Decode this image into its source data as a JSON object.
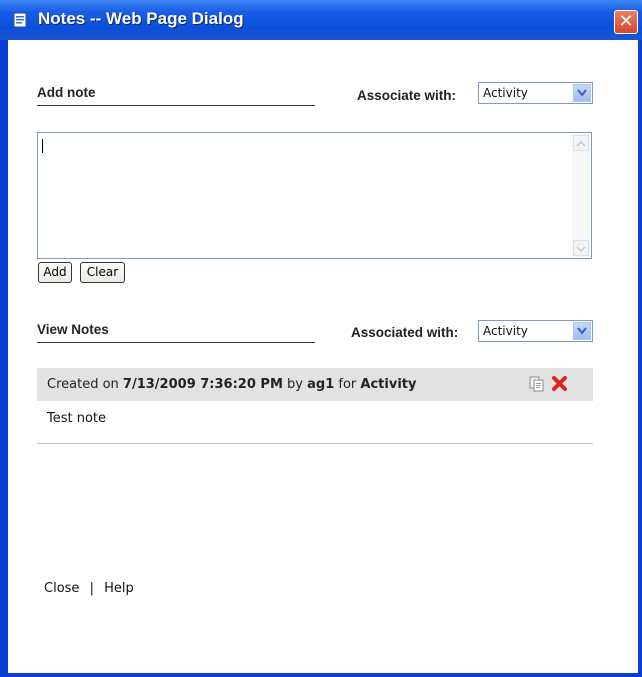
{
  "window": {
    "title": "Notes -- Web Page Dialog",
    "close_symbol": "✕"
  },
  "add_note": {
    "heading": "Add note",
    "associate_label": "Associate with:",
    "associate_value": "Activity",
    "textarea_value": "",
    "add_button": "Add",
    "clear_button": "Clear"
  },
  "view_notes": {
    "heading": "View Notes",
    "associated_label": "Associated with:",
    "associated_value": "Activity",
    "notes": [
      {
        "created_on_label": "Created on",
        "date": "7/13/2009 7:36:20 PM",
        "by_label": "by",
        "author": "ag1",
        "for_label": "for",
        "entity": "Activity",
        "text": "Test note"
      }
    ]
  },
  "footer": {
    "close_link": "Close",
    "separator": "|",
    "help_link": "Help"
  },
  "icons": {
    "title_icon": "dialog-page-icon",
    "copy_icon": "copy-icon",
    "delete_icon": "delete-x-icon"
  },
  "colors": {
    "titlebar": "#0a4fd8",
    "delete_red": "#e0241b",
    "note_header_bg": "#e2e2e2"
  }
}
